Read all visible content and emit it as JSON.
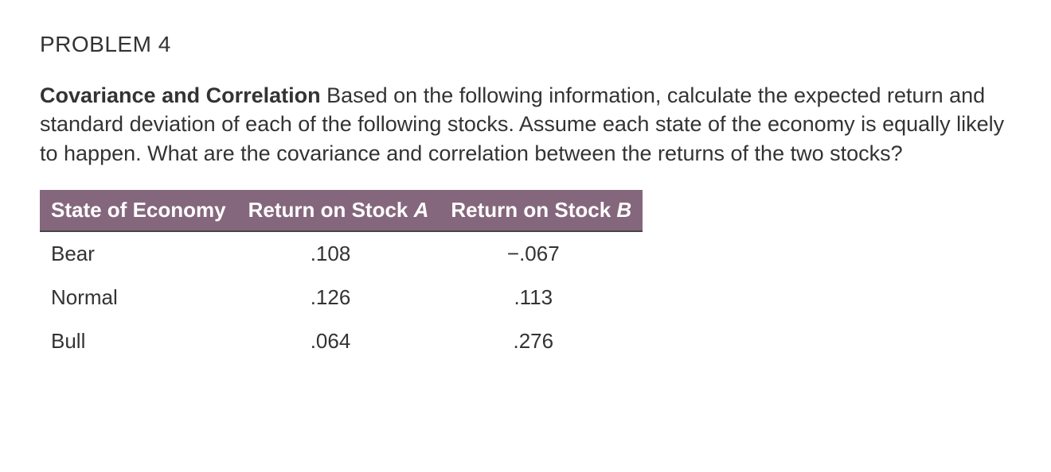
{
  "title": "PROBLEM 4",
  "lead": "Covariance and Correlation",
  "body": " Based on the following information, calculate the expected return and standard deviation of each of the following stocks. Assume each state of the economy is equally likely to happen. What are the covariance and correlation between the returns of the two stocks?",
  "table": {
    "headers": {
      "col1": "State of Economy",
      "col2_prefix": "Return on Stock ",
      "col2_ital": "A",
      "col3_prefix": "Return on Stock ",
      "col3_ital": "B"
    },
    "rows": [
      {
        "state": "Bear",
        "a": ".108",
        "b": "−.067"
      },
      {
        "state": "Normal",
        "a": ".126",
        "b": ".113"
      },
      {
        "state": "Bull",
        "a": ".064",
        "b": ".276"
      }
    ]
  },
  "chart_data": {
    "type": "table",
    "columns": [
      "State of Economy",
      "Return on Stock A",
      "Return on Stock B"
    ],
    "rows": [
      [
        "Bear",
        0.108,
        -0.067
      ],
      [
        "Normal",
        0.126,
        0.113
      ],
      [
        "Bull",
        0.064,
        0.276
      ]
    ]
  }
}
